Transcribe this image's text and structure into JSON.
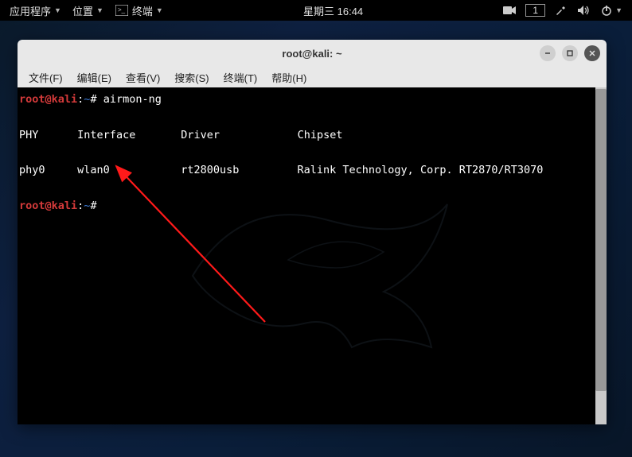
{
  "panel": {
    "apps": "应用程序",
    "places": "位置",
    "terminal": "终端",
    "datetime": "星期三 16:44",
    "workspace": "1"
  },
  "window": {
    "title": "root@kali: ~",
    "menu": {
      "file": "文件(F)",
      "edit": "编辑(E)",
      "view": "查看(V)",
      "search": "搜索(S)",
      "terminal": "终端(T)",
      "help": "帮助(H)"
    }
  },
  "prompt": {
    "user": "root@kali",
    "path": "~",
    "symbol": "#"
  },
  "command": "airmon-ng",
  "headers": {
    "phy": "PHY",
    "interface": "Interface",
    "driver": "Driver",
    "chipset": "Chipset"
  },
  "row": {
    "phy": "phy0",
    "interface": "wlan0",
    "driver": "rt2800usb",
    "chipset": "Ralink Technology, Corp. RT2870/RT3070"
  }
}
